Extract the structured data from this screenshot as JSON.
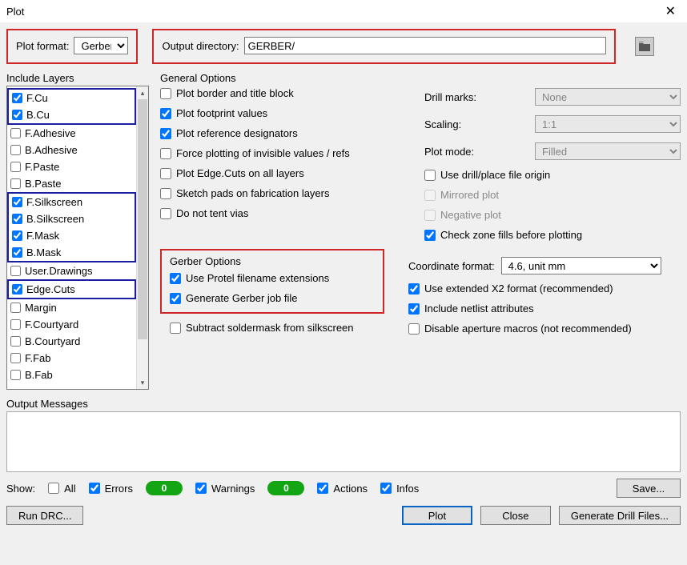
{
  "window": {
    "title": "Plot"
  },
  "top": {
    "format_label": "Plot format:",
    "format_value": "Gerber",
    "outdir_label": "Output directory:",
    "outdir_value": "GERBER/"
  },
  "layers": {
    "title": "Include Layers",
    "items": [
      {
        "label": "F.Cu",
        "checked": true
      },
      {
        "label": "B.Cu",
        "checked": true
      },
      {
        "label": "F.Adhesive",
        "checked": false
      },
      {
        "label": "B.Adhesive",
        "checked": false
      },
      {
        "label": "F.Paste",
        "checked": false
      },
      {
        "label": "B.Paste",
        "checked": false
      },
      {
        "label": "F.Silkscreen",
        "checked": true
      },
      {
        "label": "B.Silkscreen",
        "checked": true
      },
      {
        "label": "F.Mask",
        "checked": true
      },
      {
        "label": "B.Mask",
        "checked": true
      },
      {
        "label": "User.Drawings",
        "checked": false
      },
      {
        "label": "Edge.Cuts",
        "checked": true
      },
      {
        "label": "Margin",
        "checked": false
      },
      {
        "label": "F.Courtyard",
        "checked": false
      },
      {
        "label": "B.Courtyard",
        "checked": false
      },
      {
        "label": "F.Fab",
        "checked": false
      },
      {
        "label": "B.Fab",
        "checked": false
      }
    ]
  },
  "general": {
    "title": "General Options",
    "border": "Plot border and title block",
    "footprint": "Plot footprint values",
    "refdes": "Plot reference designators",
    "force": "Force plotting of invisible values / refs",
    "edgecuts": "Plot Edge.Cuts on all layers",
    "sketch": "Sketch pads on fabrication layers",
    "tent": "Do not tent vias",
    "drill_label": "Drill marks:",
    "drill_value": "None",
    "scaling_label": "Scaling:",
    "scaling_value": "1:1",
    "mode_label": "Plot mode:",
    "mode_value": "Filled",
    "origin": "Use drill/place file origin",
    "mirror": "Mirrored plot",
    "negative": "Negative plot",
    "zone": "Check zone fills before plotting"
  },
  "gerber": {
    "title": "Gerber Options",
    "protel": "Use Protel filename extensions",
    "jobfile": "Generate Gerber job file",
    "subtract": "Subtract soldermask from silkscreen",
    "coord_label": "Coordinate format:",
    "coord_value": "4.6, unit mm",
    "x2": "Use extended X2 format (recommended)",
    "netlist": "Include netlist attributes",
    "aperture": "Disable aperture macros (not recommended)"
  },
  "output": {
    "title": "Output Messages"
  },
  "show": {
    "label": "Show:",
    "all": "All",
    "errors": "Errors",
    "errors_count": "0",
    "warnings": "Warnings",
    "warnings_count": "0",
    "actions": "Actions",
    "infos": "Infos",
    "save": "Save..."
  },
  "buttons": {
    "drc": "Run DRC...",
    "plot": "Plot",
    "close": "Close",
    "drill": "Generate Drill Files..."
  }
}
